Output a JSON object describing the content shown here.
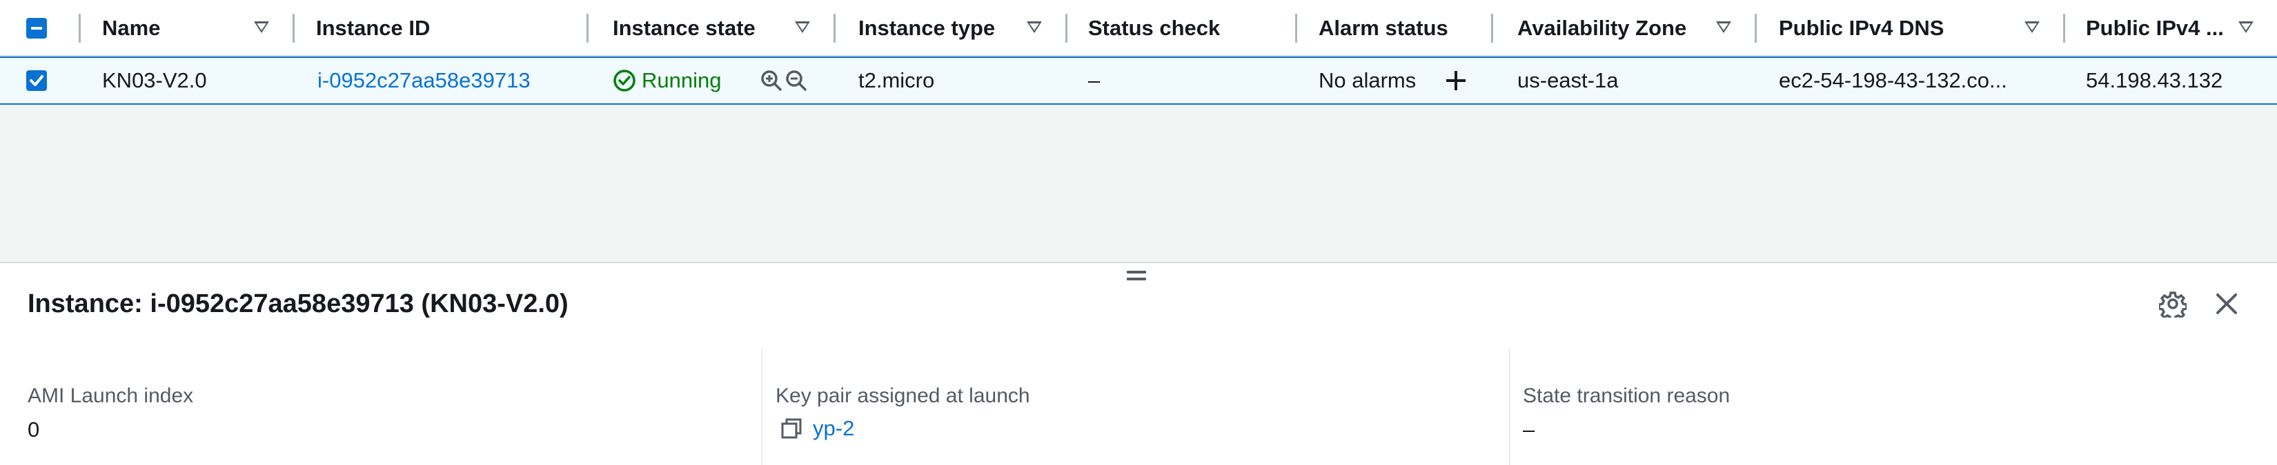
{
  "table": {
    "columns": [
      {
        "label": "Name"
      },
      {
        "label": "Instance ID"
      },
      {
        "label": "Instance state"
      },
      {
        "label": "Instance type"
      },
      {
        "label": "Status check"
      },
      {
        "label": "Alarm status"
      },
      {
        "label": "Availability Zone"
      },
      {
        "label": "Public IPv4 DNS"
      },
      {
        "label": "Public IPv4 ..."
      }
    ],
    "rows": [
      {
        "selected": true,
        "name": "KN03-V2.0",
        "instance_id": "i-0952c27aa58e39713",
        "state": "Running",
        "type": "t2.micro",
        "status_check": "–",
        "alarm_status": "No alarms",
        "az": "us-east-1a",
        "dns": "ec2-54-198-43-132.co...",
        "ipv4": "54.198.43.132"
      }
    ]
  },
  "detail": {
    "title": "Instance: i-0952c27aa58e39713 (KN03-V2.0)",
    "fields": [
      {
        "label": "AMI Launch index",
        "value": "0"
      },
      {
        "label": "Key pair assigned at launch",
        "value": "yp-2"
      },
      {
        "label": "State transition reason",
        "value": "–"
      }
    ]
  },
  "colors": {
    "accent": "#0972d3",
    "running": "#037f0c",
    "selected_row_bg": "#f1faff",
    "empty_bg": "#f2f3f3"
  },
  "icons": [
    "minus-checkbox-icon",
    "checked-checkbox-icon",
    "sort-down-icon",
    "running-check-icon",
    "zoom-in-icon",
    "zoom-out-icon",
    "plus-icon",
    "resize-grip-icon",
    "gear-icon",
    "close-icon",
    "copy-icon"
  ]
}
